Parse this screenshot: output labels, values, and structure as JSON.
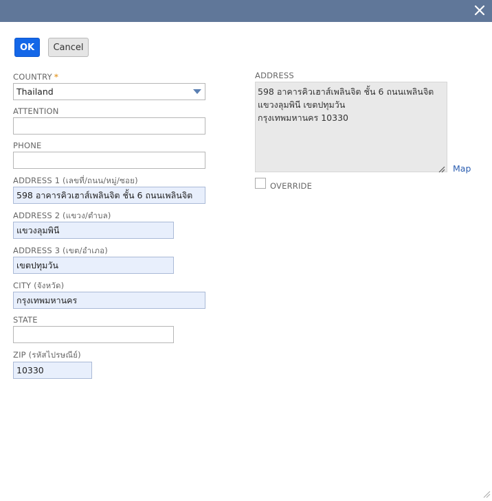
{
  "dialog": {
    "close_icon": "close-icon"
  },
  "buttons": {
    "ok": "OK",
    "cancel": "Cancel"
  },
  "form": {
    "country": {
      "label": "COUNTRY",
      "required_mark": "*",
      "value": "Thailand"
    },
    "attention": {
      "label": "ATTENTION",
      "value": ""
    },
    "phone": {
      "label": "PHONE",
      "value": ""
    },
    "address1": {
      "label": "ADDRESS 1 (เลขที่/ถนน/หมู่/ซอย)",
      "value": "598 อาคารคิวเฮาส์เพลินจิต ชั้น 6 ถนนเพลินจิต"
    },
    "address2": {
      "label": "ADDRESS 2 (แขวง/ตำบล)",
      "value": "แขวงลุมพินี"
    },
    "address3": {
      "label": "ADDRESS 3 (เขต/อำเภอ)",
      "value": "เขตปทุมวัน"
    },
    "city": {
      "label": "CITY (จังหวัด)",
      "value": "กรุงเทพมหานคร"
    },
    "state": {
      "label": "STATE",
      "value": ""
    },
    "zip": {
      "label": "ZIP (รหัสไปรษณีย์)",
      "value": "10330"
    }
  },
  "address_preview": {
    "label": "ADDRESS",
    "lines": [
      "598 อาคารคิวเฮาส์เพลินจิต ชั้น 6 ถนนเพลินจิต",
      "แขวงลุมพินี เขตปทุมวัน",
      "กรุงเทพมหานคร  10330"
    ],
    "map_link": "Map",
    "override_label": "OVERRIDE",
    "override_checked": false
  },
  "colors": {
    "titlebar": "#607799",
    "primary_button": "#1467e8",
    "filled_field": "#e8effc"
  }
}
